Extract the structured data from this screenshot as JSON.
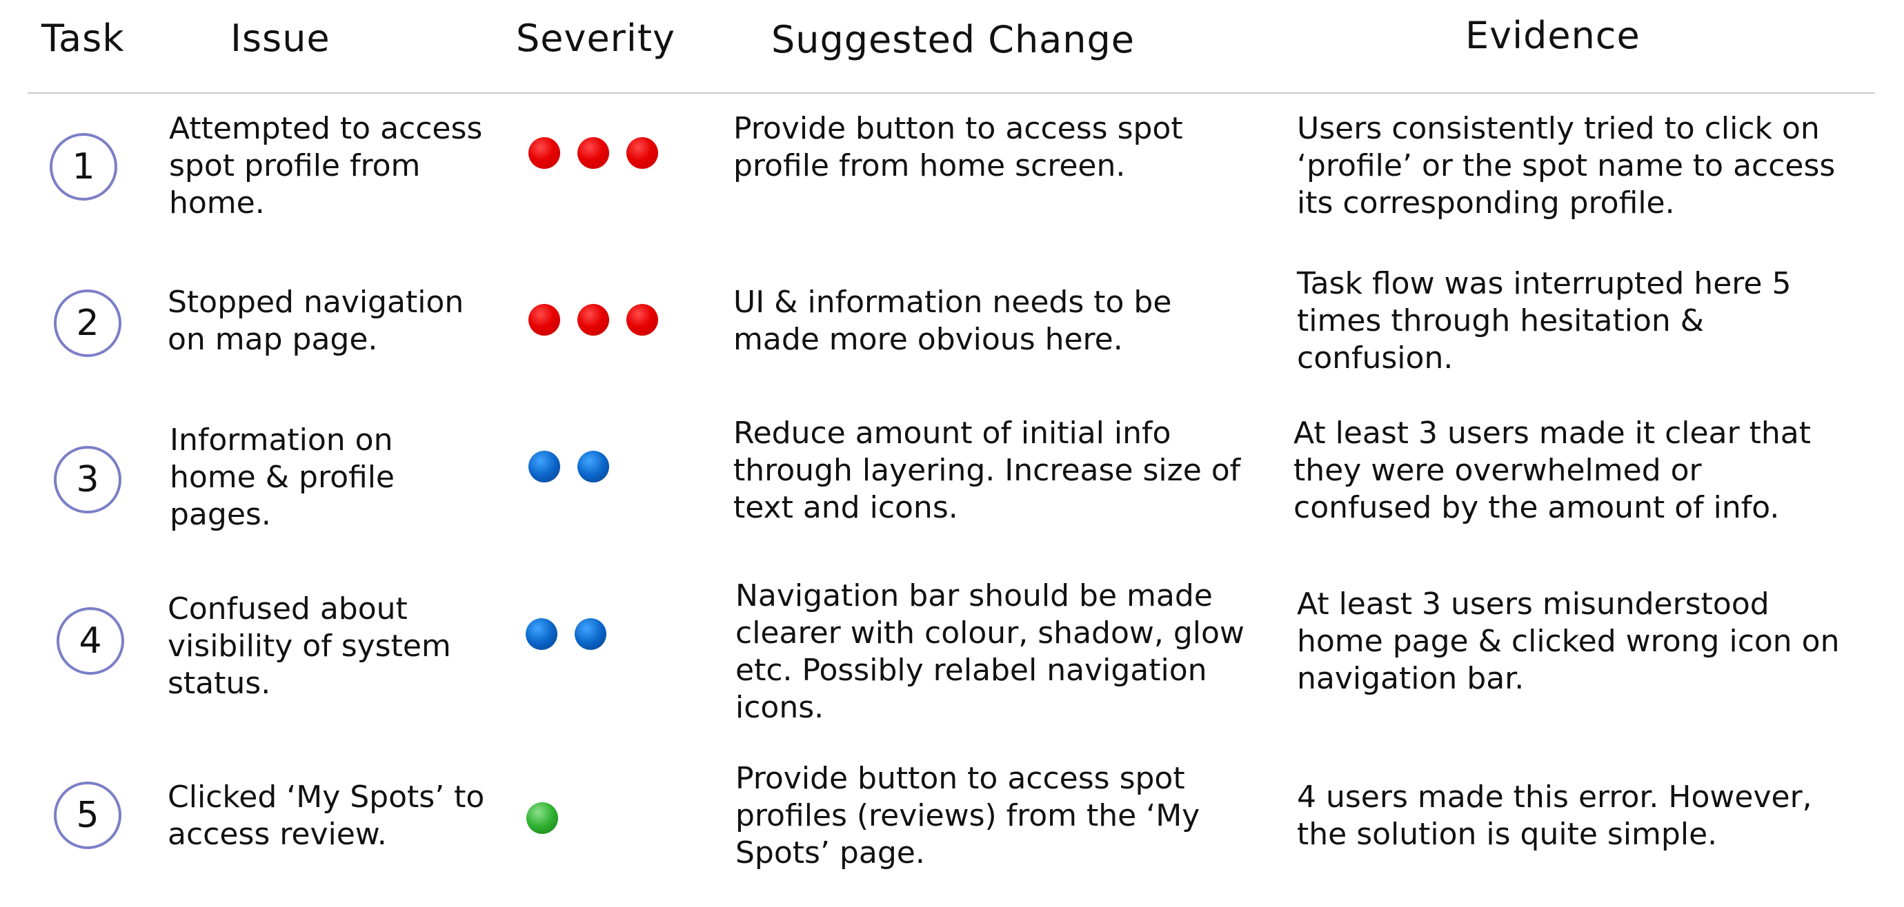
{
  "headers": {
    "task": "Task",
    "issue": "Issue",
    "severity": "Severity",
    "suggested_change": "Suggested Change",
    "evidence": "Evidence"
  },
  "severity_colors": {
    "high": "#e00000",
    "medium": "#0b66c9",
    "low": "#2fb02f"
  },
  "rows": [
    {
      "task": "1",
      "issue": "Attempted to access spot profile from home.",
      "severity_level": "high",
      "severity_count": 3,
      "suggested_change": "Provide button to access spot profile from home screen.",
      "evidence": "Users consistently tried to click on ‘profile’ or the spot name to access its corresponding profile."
    },
    {
      "task": "2",
      "issue": "Stopped navigation on map page.",
      "severity_level": "high",
      "severity_count": 3,
      "suggested_change": "UI & information needs to be made more obvious here.",
      "evidence": "Task flow was interrupted here 5 times through hesitation & confusion."
    },
    {
      "task": "3",
      "issue": "Information on home & profile pages.",
      "severity_level": "medium",
      "severity_count": 2,
      "suggested_change": "Reduce amount of initial info through layering. Increase size of text and icons.",
      "evidence": "At least 3 users made it clear that they were overwhelmed or confused by the amount of info."
    },
    {
      "task": "4",
      "issue": "Confused about visibility of system status.",
      "severity_level": "medium",
      "severity_count": 2,
      "suggested_change": "Navigation bar should be made clearer with colour, shadow, glow etc. Possibly relabel navigation icons.",
      "evidence": "At least 3 users misunderstood home page & clicked wrong icon on navigation bar."
    },
    {
      "task": "5",
      "issue": "Clicked ‘My Spots’ to access review.",
      "severity_level": "low",
      "severity_count": 1,
      "suggested_change": "Provide button to access spot profiles (reviews) from the ‘My Spots’ page.",
      "evidence": "4 users made this error. However, the solution is quite simple."
    }
  ]
}
